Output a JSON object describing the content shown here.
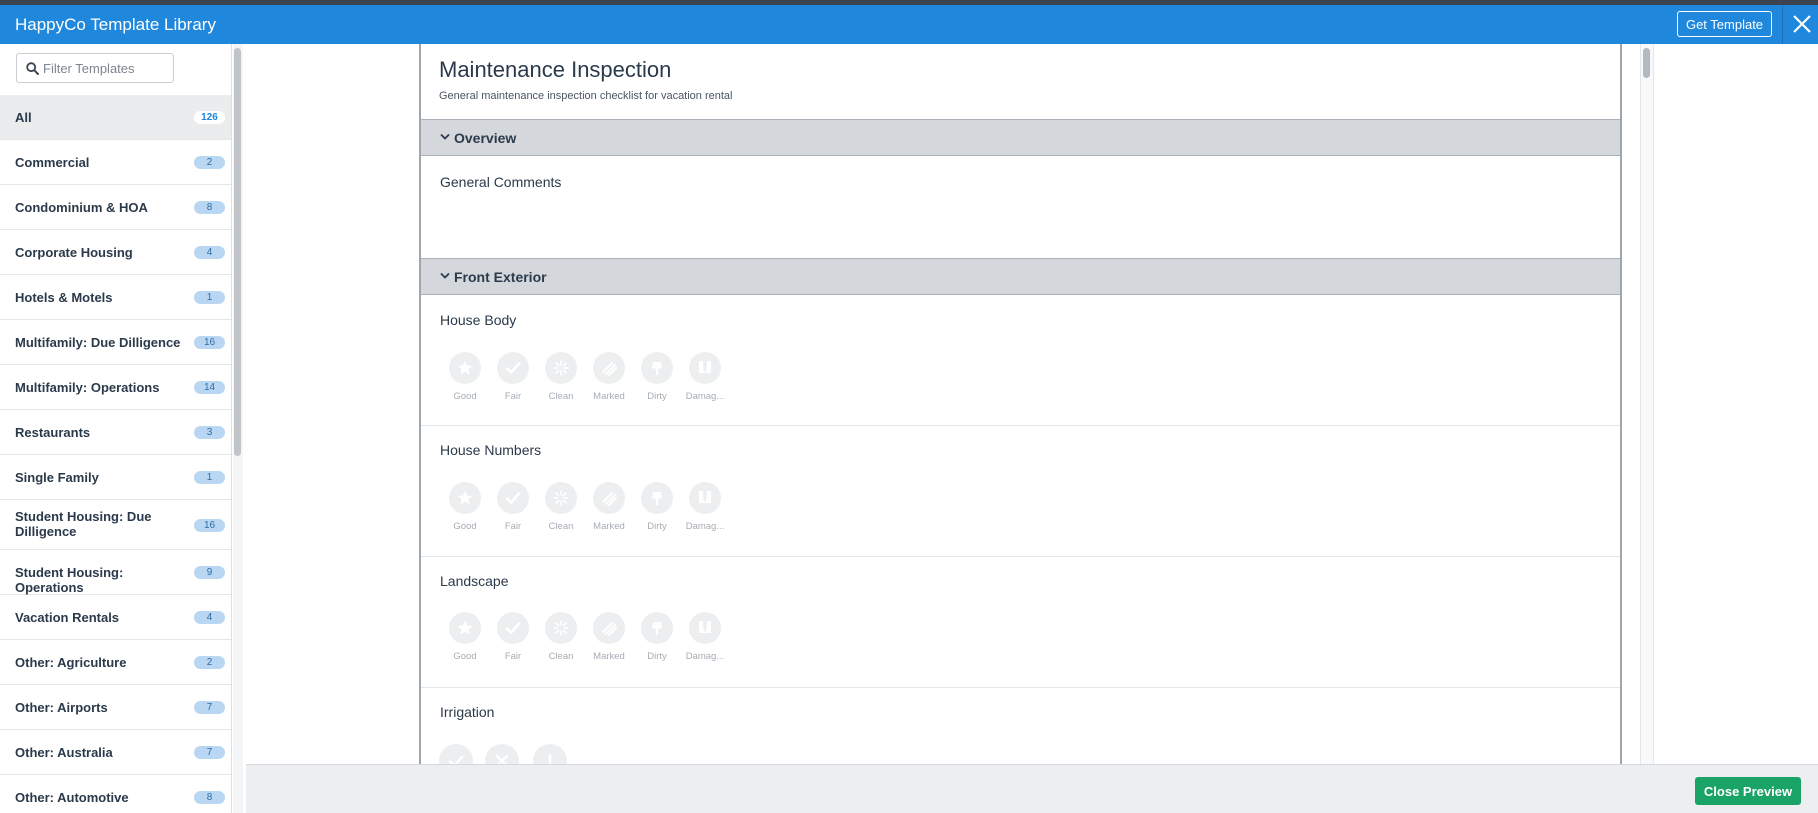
{
  "header": {
    "title": "HappyCo Template Library",
    "get_template_label": "Get Template",
    "close_icon": "close-icon"
  },
  "sidebar": {
    "filter_placeholder": "Filter Templates",
    "filter_value": "",
    "categories": [
      {
        "label": "All",
        "count": "126",
        "selected": true
      },
      {
        "label": "Commercial",
        "count": "2"
      },
      {
        "label": "Condominium & HOA",
        "count": "8"
      },
      {
        "label": "Corporate Housing",
        "count": "4"
      },
      {
        "label": "Hotels & Motels",
        "count": "1"
      },
      {
        "label": "Multifamily: Due Dilligence",
        "count": "16"
      },
      {
        "label": "Multifamily: Operations",
        "count": "14"
      },
      {
        "label": "Restaurants",
        "count": "3"
      },
      {
        "label": "Single Family",
        "count": "1"
      },
      {
        "label": "Student Housing: Due Dilligence",
        "count": "16"
      },
      {
        "label": "Student Housing: Operations",
        "count": "9"
      },
      {
        "label": "Vacation Rentals",
        "count": "4"
      },
      {
        "label": "Other: Agriculture",
        "count": "2"
      },
      {
        "label": "Other: Airports",
        "count": "7"
      },
      {
        "label": "Other: Australia",
        "count": "7"
      },
      {
        "label": "Other: Automotive",
        "count": "8"
      }
    ]
  },
  "preview": {
    "title": "Maintenance Inspection",
    "subtitle": "General maintenance inspection checklist for vacation rental",
    "sections": [
      {
        "label": "Overview",
        "items": [
          {
            "title": "General Comments"
          }
        ]
      },
      {
        "label": "Front Exterior",
        "items": [
          {
            "title": "House Body"
          },
          {
            "title": "House Numbers"
          },
          {
            "title": "Landscape"
          },
          {
            "title": "Irrigation"
          }
        ]
      }
    ],
    "rating_options": [
      {
        "label": "Good",
        "icon": "star-icon"
      },
      {
        "label": "Fair",
        "icon": "check-icon"
      },
      {
        "label": "Clean",
        "icon": "sparkle-icon"
      },
      {
        "label": "Marked",
        "icon": "marked-icon"
      },
      {
        "label": "Dirty",
        "icon": "dirt-icon"
      },
      {
        "label": "Damag...",
        "icon": "damage-icon"
      }
    ],
    "irrigation_options": [
      "check-icon",
      "cross-icon",
      "exclamation-icon"
    ]
  },
  "footer": {
    "close_preview_label": "Close Preview"
  },
  "colors": {
    "header_blue": "#1f87dc",
    "badge_blue": "#b9d7f2",
    "section_gray": "#d4d8dc",
    "close_preview_green": "#1aa367"
  }
}
